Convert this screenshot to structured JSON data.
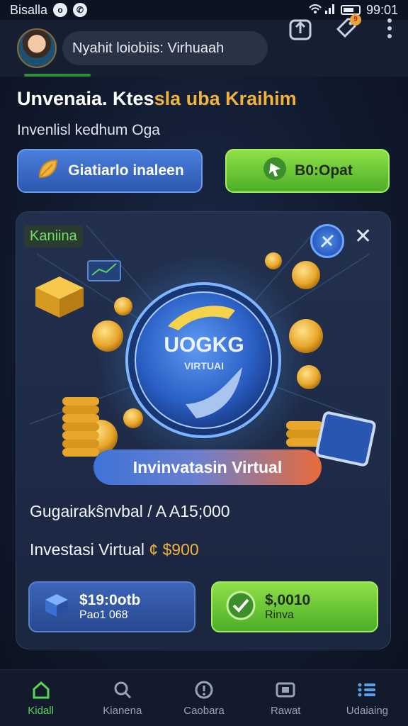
{
  "status_bar": {
    "carrier": "Bisalla",
    "time": "99:01"
  },
  "header": {
    "search_text": "Nyahit loiobiis: Virhuaah"
  },
  "headline": {
    "main": "Unvenaia. Ktes",
    "accent": "sla uba Kraihim"
  },
  "subhead": "Invenlisl kedhum Oga",
  "top_buttons": {
    "left": "Giatiarlo inaleen",
    "right": "B0:Opat"
  },
  "card": {
    "tag": "Kaniina",
    "close": "✕",
    "logo_title": "UOGKG",
    "logo_sub": "VIRTUAI",
    "label": "Invinvatasin Virtual",
    "info1": "Gugairakŝnvbal / A A15;000",
    "info2_text": "Investasi Virtual",
    "info2_price": "¢ $900",
    "button_left": {
      "main": "$19:0otb",
      "sub": "Pao1 068"
    },
    "button_right": {
      "main": "$,0010",
      "sub": "Rinva"
    }
  },
  "bottom_nav": [
    {
      "label": "Kidall"
    },
    {
      "label": "Kianena"
    },
    {
      "label": "Caobara"
    },
    {
      "label": "Rawat"
    },
    {
      "label": "Udaiaing"
    }
  ],
  "colors": {
    "accent_gold": "#f0b43a",
    "accent_green": "#57d65a",
    "accent_blue": "#3f73d6"
  }
}
